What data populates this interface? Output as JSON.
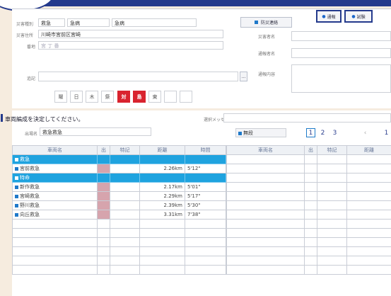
{
  "form": {
    "category": {
      "label": "災害種別",
      "v1": "救急",
      "v2": "急病",
      "v3": "急病"
    },
    "address": {
      "label": "災害住所",
      "value": "川崎市宮前区宮崎"
    },
    "addr2": {
      "label": "番地",
      "value": "宮 丁 番"
    },
    "note": {
      "label": "追記",
      "value": ""
    },
    "days": [
      "曜",
      "日",
      "木",
      "祭",
      "対",
      "島",
      "東",
      "",
      ""
    ],
    "ellipsis": "…",
    "right": {
      "name_label": "災害者名",
      "reporter_label": "通報者名",
      "content_label": "通報内容"
    }
  },
  "buttons": {
    "contact": "防災連絡",
    "notify": "通報",
    "test": "試験"
  },
  "lower": {
    "instruction": "車両編成を決定してください。",
    "message_label": "選択メッセージ",
    "unit_label": "出場名",
    "unit_value": "救急救急",
    "left_headers": [
      "車両名",
      "出",
      "特記",
      "距離",
      "時間"
    ],
    "rows": [
      {
        "type": "group",
        "name": "救急"
      },
      {
        "type": "row",
        "name": "宮前救急",
        "dist": "2.26km",
        "time": "5'12\""
      },
      {
        "type": "group",
        "name": "特命"
      },
      {
        "type": "row",
        "name": "新作救急",
        "dist": "2.17km",
        "time": "5'01\""
      },
      {
        "type": "row",
        "name": "宮崎救急",
        "dist": "2.29km",
        "time": "5'17\""
      },
      {
        "type": "row",
        "name": "野川救急",
        "dist": "2.39km",
        "time": "5'30\""
      },
      {
        "type": "row",
        "name": "向丘救急",
        "dist": "3.31km",
        "time": "7'38\""
      }
    ],
    "right_select": "無段",
    "pages": [
      "1",
      "2",
      "3",
      "‹",
      "1"
    ],
    "right_headers": [
      "車両名",
      "出",
      "特記",
      "距離"
    ]
  }
}
